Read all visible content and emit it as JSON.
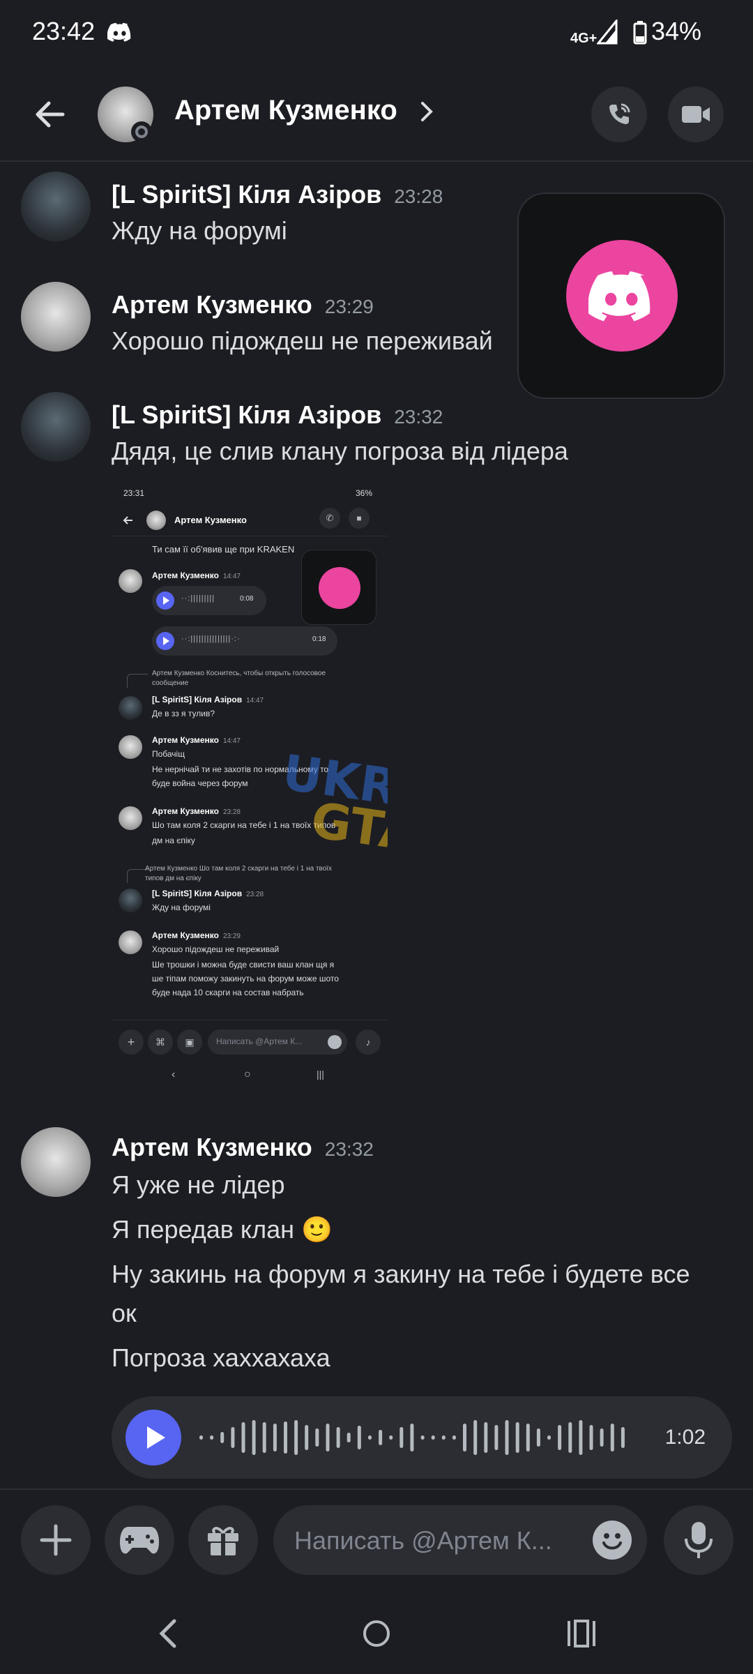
{
  "status_bar": {
    "time": "23:42",
    "network": "4G+",
    "battery": "34%"
  },
  "header": {
    "contact_name": "Артем Кузменко"
  },
  "messages": [
    {
      "author": "[L SpiritS] Кіля Азіров",
      "time": "23:28",
      "lines": [
        "Жду на форумі"
      ]
    },
    {
      "author": "Артем Кузменко",
      "time": "23:29",
      "lines": [
        "Хорошо підождеш не переживай"
      ]
    },
    {
      "author": "[L SpiritS] Кіля Азіров",
      "time": "23:32",
      "lines": [
        "Дядя, це слив клану погроза від лідера"
      ]
    },
    {
      "author": "Артем Кузменко",
      "time": "23:32",
      "lines": [
        "Я уже не лідер",
        "Я передав клан 🙂",
        "Ну закинь на форум я закину на тебе і будете все",
        "ок",
        "Погроза  хаххахаха"
      ]
    }
  ],
  "voice_message": {
    "duration": "1:02"
  },
  "attachment": {
    "status_time": "23:31",
    "battery": "36%",
    "contact_name": "Артем Кузменко",
    "top_line": "Ти сам її об'явив ще при KRAKEN",
    "m1_author": "Артем Кузменко",
    "m1_time": "14:47",
    "voice1": "0:08",
    "voice2": "0:18",
    "reply1": "Артем Кузменко Коснитесь, чтобы открыть голосовое",
    "reply1b": "сообщение",
    "m2_author": "[L SpiritS] Кіля Азіров",
    "m2_time": "14:47",
    "m2_text": "Де в зз я тулив?",
    "m3_author": "Артем Кузменко",
    "m3_time": "14:47",
    "m3_l1": "Побачіщ",
    "m3_l2": "Не нернічай ти не захотів по нормальному то",
    "m3_l3": "буде война через форум",
    "m4_author": "Артем Кузменко",
    "m4_time": "23:28",
    "m4_l1": "Шо там коля 2 скарги на тебе і 1 на твоїх типов",
    "m4_l2": "дм на єпіку",
    "reply2": "Артем Кузменко Шо там коля 2 скарги на тебе і 1 на твоїх",
    "reply2b": "типов дм на єпіку",
    "m5_author": "[L SpiritS] Кіля Азіров",
    "m5_time": "23:28",
    "m5_text": "Жду на форумі",
    "m6_author": "Артем Кузменко",
    "m6_time": "23:29",
    "m6_l1": "Хорошо підождеш не переживай",
    "m6_l2": "Ше трошки і можна буде свисти ваш клан щя я",
    "m6_l3": "ше тіпам поможу закинуть на форум може шото",
    "m6_l4": "буде  нада 10 скарги на состав набрать",
    "input_placeholder": "Написать @Артем К...",
    "watermark1": "UKRAINE",
    "watermark2": "GTA"
  },
  "input": {
    "placeholder": "Написать @Артем К..."
  },
  "colors": {
    "background": "#1c1d22",
    "accent": "#5865f2",
    "discord_pink": "#eb459f"
  }
}
